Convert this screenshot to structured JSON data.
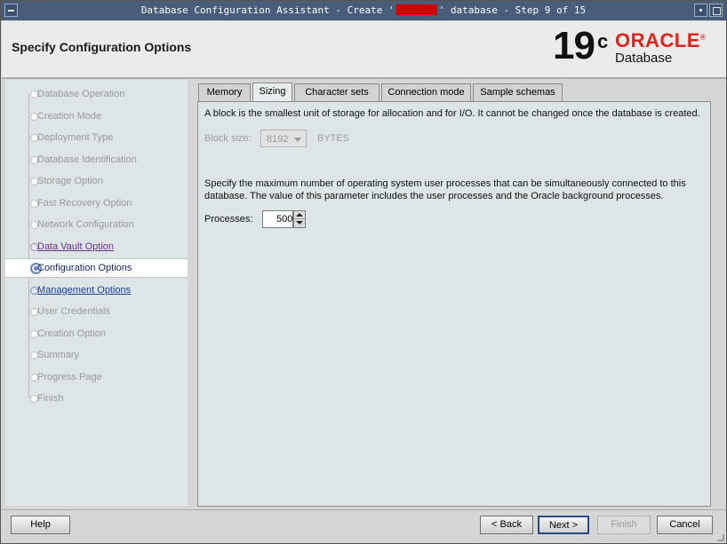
{
  "window": {
    "title_prefix": "Database Configuration Assistant - Create '",
    "title_suffix": "' database - Step 9 of 15"
  },
  "header": {
    "page_title": "Specify Configuration Options",
    "logo_version": "19",
    "logo_version_sup": "c",
    "logo_brand": "ORACLE",
    "logo_brand_mark": "®",
    "logo_product": "Database"
  },
  "nav": {
    "items": [
      {
        "label": "Database Operation",
        "state": "inactive"
      },
      {
        "label": "Creation Mode",
        "state": "inactive"
      },
      {
        "label": "Deployment Type",
        "state": "inactive"
      },
      {
        "label": "Database Identification",
        "state": "inactive"
      },
      {
        "label": "Storage Option",
        "state": "inactive"
      },
      {
        "label": "Fast Recovery Option",
        "state": "inactive"
      },
      {
        "label": "Network Configuration",
        "state": "inactive"
      },
      {
        "label": "Data Vault Option",
        "state": "visited"
      },
      {
        "label": "Configuration Options",
        "state": "current"
      },
      {
        "label": "Management Options",
        "state": "next"
      },
      {
        "label": "User Credentials",
        "state": "inactive"
      },
      {
        "label": "Creation Option",
        "state": "inactive"
      },
      {
        "label": "Summary",
        "state": "inactive"
      },
      {
        "label": "Progress Page",
        "state": "inactive"
      },
      {
        "label": "Finish",
        "state": "inactive"
      }
    ]
  },
  "tabs": {
    "memory": "Memory",
    "sizing": "Sizing",
    "character_sets": "Character sets",
    "connection_mode": "Connection mode",
    "sample_schemas": "Sample schemas",
    "active": "Sizing"
  },
  "sizing": {
    "block_desc": "A block is the smallest unit of storage for allocation and for I/O. It cannot be changed once the database is created.",
    "block_size_label": "Block size:",
    "block_size_value": "8192",
    "block_size_unit": "BYTES",
    "processes_desc_line1": "Specify the maximum number of operating system user processes that can be simultaneously connected to this",
    "processes_desc_line2": "database. The value of this parameter includes the user processes and the Oracle background processes.",
    "processes_label": "Processes:",
    "processes_value": "500"
  },
  "footer": {
    "help": "Help",
    "back": "< Back",
    "next": "Next >",
    "finish": "Finish",
    "cancel": "Cancel"
  }
}
